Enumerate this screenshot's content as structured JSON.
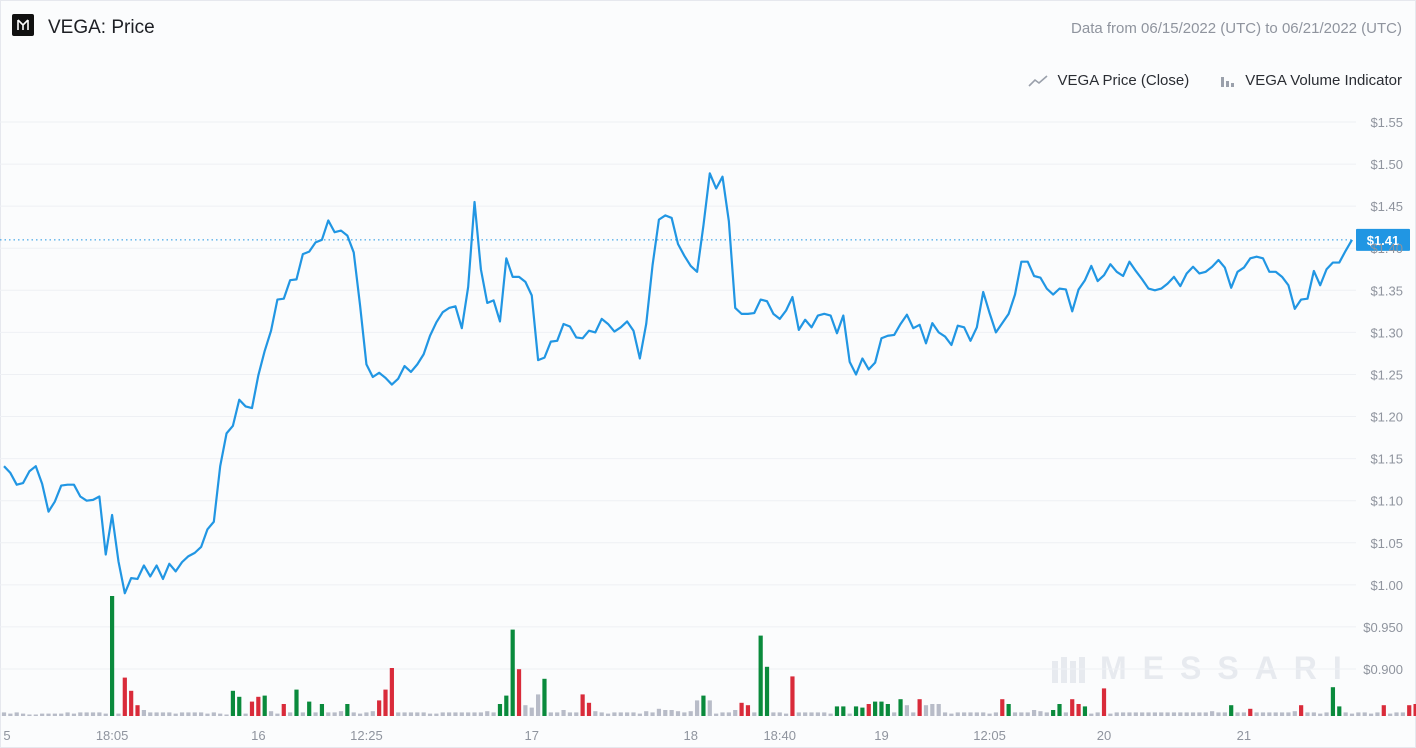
{
  "header": {
    "title": "VEGA: Price",
    "date_range": "Data from 06/15/2022 (UTC) to 06/21/2022 (UTC)"
  },
  "legend": {
    "price_label": "VEGA Price (Close)",
    "volume_label": "VEGA Volume Indicator"
  },
  "watermark": "MESSARI",
  "colors": {
    "price_line": "#2196e3",
    "volume_up": "#0a8a3c",
    "volume_down": "#d92b3a",
    "volume_neutral": "#b8bcc8",
    "current_label_bg": "#2196e3",
    "grid": "#eef0f4"
  },
  "chart_data": {
    "type": "line",
    "series": [
      {
        "name": "VEGA Price (Close)",
        "values": [
          1.141,
          1.133,
          1.119,
          1.121,
          1.135,
          1.141,
          1.12,
          1.087,
          1.099,
          1.118,
          1.119,
          1.119,
          1.105,
          1.1,
          1.101,
          1.105,
          1.036,
          1.083,
          1.028,
          0.99,
          1.008,
          1.007,
          1.023,
          1.01,
          1.023,
          1.007,
          1.025,
          1.016,
          1.027,
          1.034,
          1.038,
          1.045,
          1.066,
          1.075,
          1.141,
          1.18,
          1.189,
          1.22,
          1.212,
          1.21,
          1.249,
          1.278,
          1.302,
          1.339,
          1.34,
          1.362,
          1.363,
          1.393,
          1.396,
          1.407,
          1.41,
          1.433,
          1.419,
          1.421,
          1.415,
          1.395,
          1.332,
          1.262,
          1.247,
          1.252,
          1.246,
          1.238,
          1.245,
          1.26,
          1.253,
          1.262,
          1.274,
          1.296,
          1.312,
          1.324,
          1.329,
          1.331,
          1.305,
          1.354,
          1.455,
          1.375,
          1.335,
          1.338,
          1.313,
          1.388,
          1.366,
          1.366,
          1.36,
          1.344,
          1.267,
          1.27,
          1.289,
          1.29,
          1.31,
          1.307,
          1.294,
          1.293,
          1.302,
          1.3,
          1.316,
          1.31,
          1.301,
          1.306,
          1.313,
          1.302,
          1.269,
          1.31,
          1.38,
          1.434,
          1.439,
          1.436,
          1.405,
          1.391,
          1.379,
          1.372,
          1.427,
          1.489,
          1.471,
          1.485,
          1.432,
          1.329,
          1.322,
          1.322,
          1.323,
          1.339,
          1.337,
          1.322,
          1.316,
          1.326,
          1.342,
          1.303,
          1.315,
          1.306,
          1.32,
          1.322,
          1.32,
          1.299,
          1.32,
          1.265,
          1.25,
          1.269,
          1.256,
          1.264,
          1.293,
          1.296,
          1.297,
          1.31,
          1.321,
          1.305,
          1.309,
          1.287,
          1.311,
          1.3,
          1.295,
          1.285,
          1.308,
          1.306,
          1.29,
          1.306,
          1.348,
          1.323,
          1.3,
          1.311,
          1.322,
          1.345,
          1.384,
          1.384,
          1.367,
          1.365,
          1.352,
          1.345,
          1.352,
          1.351,
          1.325,
          1.351,
          1.362,
          1.379,
          1.361,
          1.368,
          1.381,
          1.372,
          1.367,
          1.384,
          1.373,
          1.363,
          1.352,
          1.35,
          1.352,
          1.358,
          1.366,
          1.355,
          1.37,
          1.378,
          1.37,
          1.372,
          1.378,
          1.386,
          1.377,
          1.353,
          1.372,
          1.377,
          1.388,
          1.39,
          1.388,
          1.372,
          1.372,
          1.366,
          1.356,
          1.328,
          1.339,
          1.34,
          1.373,
          1.356,
          1.375,
          1.383,
          1.383,
          1.397,
          1.41
        ]
      },
      {
        "name": "VEGA Volume Indicator",
        "values": [
          3,
          2,
          3,
          2,
          1,
          1,
          2,
          2,
          2,
          2,
          3,
          2,
          3,
          3,
          3,
          3,
          2,
          22,
          2,
          8,
          5,
          3,
          5,
          3,
          3,
          3,
          3,
          2,
          3,
          3,
          3,
          3,
          2,
          3,
          2,
          1,
          4,
          4,
          2,
          3,
          3,
          3,
          4,
          2,
          3,
          3,
          2,
          3,
          2,
          3,
          3,
          3,
          3,
          4,
          2,
          3,
          2,
          3,
          4,
          3,
          3,
          2,
          3,
          3,
          3,
          3,
          3,
          2,
          2,
          3,
          3,
          3,
          3,
          3,
          3,
          3,
          4,
          3,
          5,
          6,
          7,
          6,
          9,
          7,
          5,
          3,
          3,
          3,
          5,
          3,
          3,
          2,
          3,
          4,
          3,
          2,
          3,
          3,
          3,
          3,
          2,
          4,
          3,
          6,
          5,
          5,
          4,
          3,
          4,
          3,
          3,
          2,
          2,
          3,
          3,
          5,
          5,
          3,
          3,
          3,
          3,
          3,
          3,
          2,
          3,
          3,
          3,
          3,
          3,
          3,
          2,
          3,
          2,
          2,
          3,
          3,
          2,
          3,
          2,
          3,
          3,
          3,
          2,
          3,
          3,
          3,
          4,
          3,
          3,
          2,
          3,
          3,
          3,
          3,
          3,
          2,
          3,
          3,
          2,
          3,
          3,
          3,
          5,
          4,
          3,
          3,
          3,
          3,
          2,
          3,
          3,
          2,
          3,
          3,
          2,
          3,
          3,
          3,
          3,
          3,
          3,
          3,
          3,
          3,
          3,
          3,
          3,
          3,
          3,
          3,
          4,
          3,
          3,
          3,
          3,
          3,
          3,
          3,
          3,
          3,
          3,
          3,
          3,
          4,
          3,
          3,
          3,
          2,
          3,
          3,
          3,
          3,
          2,
          3,
          3,
          2,
          3,
          3,
          2,
          3,
          3,
          3,
          3,
          3,
          3,
          3,
          3,
          3,
          2,
          3,
          3,
          2,
          3,
          3,
          2,
          4,
          3,
          2,
          3,
          2,
          3,
          3
        ]
      }
    ],
    "volume_bars": [
      {
        "i": 17,
        "v": 100,
        "c": "up"
      },
      {
        "i": 19,
        "v": 32,
        "c": "down"
      },
      {
        "i": 20,
        "v": 21,
        "c": "down"
      },
      {
        "i": 21,
        "v": 9,
        "c": "down"
      },
      {
        "i": 36,
        "v": 21,
        "c": "up"
      },
      {
        "i": 37,
        "v": 16,
        "c": "up"
      },
      {
        "i": 39,
        "v": 12,
        "c": "down"
      },
      {
        "i": 40,
        "v": 16,
        "c": "down"
      },
      {
        "i": 41,
        "v": 17,
        "c": "up"
      },
      {
        "i": 44,
        "v": 10,
        "c": "down"
      },
      {
        "i": 46,
        "v": 22,
        "c": "up"
      },
      {
        "i": 48,
        "v": 12,
        "c": "up"
      },
      {
        "i": 50,
        "v": 10,
        "c": "up"
      },
      {
        "i": 54,
        "v": 10,
        "c": "up"
      },
      {
        "i": 59,
        "v": 13,
        "c": "down"
      },
      {
        "i": 60,
        "v": 22,
        "c": "down"
      },
      {
        "i": 61,
        "v": 40,
        "c": "down"
      },
      {
        "i": 78,
        "v": 10,
        "c": "up"
      },
      {
        "i": 79,
        "v": 17,
        "c": "up"
      },
      {
        "i": 80,
        "v": 72,
        "c": "up"
      },
      {
        "i": 81,
        "v": 39,
        "c": "down"
      },
      {
        "i": 84,
        "v": 18,
        "c": "neutral"
      },
      {
        "i": 85,
        "v": 31,
        "c": "up"
      },
      {
        "i": 91,
        "v": 18,
        "c": "down"
      },
      {
        "i": 92,
        "v": 11,
        "c": "down"
      },
      {
        "i": 109,
        "v": 13,
        "c": "neutral"
      },
      {
        "i": 110,
        "v": 17,
        "c": "up"
      },
      {
        "i": 111,
        "v": 13,
        "c": "neutral"
      },
      {
        "i": 116,
        "v": 11,
        "c": "down"
      },
      {
        "i": 117,
        "v": 9,
        "c": "down"
      },
      {
        "i": 119,
        "v": 67,
        "c": "up"
      },
      {
        "i": 120,
        "v": 41,
        "c": "up"
      },
      {
        "i": 124,
        "v": 33,
        "c": "down"
      },
      {
        "i": 131,
        "v": 8,
        "c": "up"
      },
      {
        "i": 132,
        "v": 8,
        "c": "up"
      },
      {
        "i": 134,
        "v": 8,
        "c": "up"
      },
      {
        "i": 135,
        "v": 7,
        "c": "up"
      },
      {
        "i": 136,
        "v": 10,
        "c": "down"
      },
      {
        "i": 137,
        "v": 12,
        "c": "up"
      },
      {
        "i": 138,
        "v": 12,
        "c": "up"
      },
      {
        "i": 139,
        "v": 10,
        "c": "up"
      },
      {
        "i": 141,
        "v": 14,
        "c": "up"
      },
      {
        "i": 142,
        "v": 9,
        "c": "neutral"
      },
      {
        "i": 144,
        "v": 14,
        "c": "down"
      },
      {
        "i": 145,
        "v": 9,
        "c": "neutral"
      },
      {
        "i": 146,
        "v": 10,
        "c": "neutral"
      },
      {
        "i": 147,
        "v": 10,
        "c": "neutral"
      },
      {
        "i": 157,
        "v": 14,
        "c": "down"
      },
      {
        "i": 158,
        "v": 10,
        "c": "up"
      },
      {
        "i": 165,
        "v": 5,
        "c": "up"
      },
      {
        "i": 166,
        "v": 10,
        "c": "up"
      },
      {
        "i": 168,
        "v": 14,
        "c": "down"
      },
      {
        "i": 169,
        "v": 10,
        "c": "down"
      },
      {
        "i": 170,
        "v": 8,
        "c": "up"
      },
      {
        "i": 173,
        "v": 23,
        "c": "down"
      },
      {
        "i": 193,
        "v": 9,
        "c": "up"
      },
      {
        "i": 196,
        "v": 6,
        "c": "down"
      },
      {
        "i": 204,
        "v": 9,
        "c": "down"
      },
      {
        "i": 209,
        "v": 24,
        "c": "up"
      },
      {
        "i": 210,
        "v": 8,
        "c": "up"
      },
      {
        "i": 217,
        "v": 9,
        "c": "down"
      },
      {
        "i": 221,
        "v": 9,
        "c": "down"
      },
      {
        "i": 222,
        "v": 10,
        "c": "down"
      },
      {
        "i": 225,
        "v": 9,
        "c": "up"
      },
      {
        "i": 226,
        "v": 8,
        "c": "up"
      },
      {
        "i": 228,
        "v": 11,
        "c": "up"
      }
    ],
    "ylim": [
      0.85,
      1.57
    ],
    "y_ticks": [
      "$1.55",
      "$1.50",
      "$1.45",
      "$1.40",
      "$1.35",
      "$1.30",
      "$1.25",
      "$1.20",
      "$1.15",
      "$1.10",
      "$1.05",
      "$1.00",
      "$0.950",
      "$0.900"
    ],
    "y_tick_values": [
      1.55,
      1.5,
      1.45,
      1.4,
      1.35,
      1.3,
      1.25,
      1.2,
      1.15,
      1.1,
      1.05,
      1.0,
      0.95,
      0.9
    ],
    "x_ticks": [
      "5",
      "18:05",
      "16",
      "12:25",
      "17",
      "18",
      "18:40",
      "19",
      "12:05",
      "20",
      "21"
    ],
    "x_tick_positions": [
      0,
      17,
      40,
      57,
      83,
      108,
      122,
      138,
      155,
      173,
      195
    ],
    "current_value": 1.41,
    "current_label": "$1.41",
    "grid": true,
    "legend_position": "top-right"
  }
}
